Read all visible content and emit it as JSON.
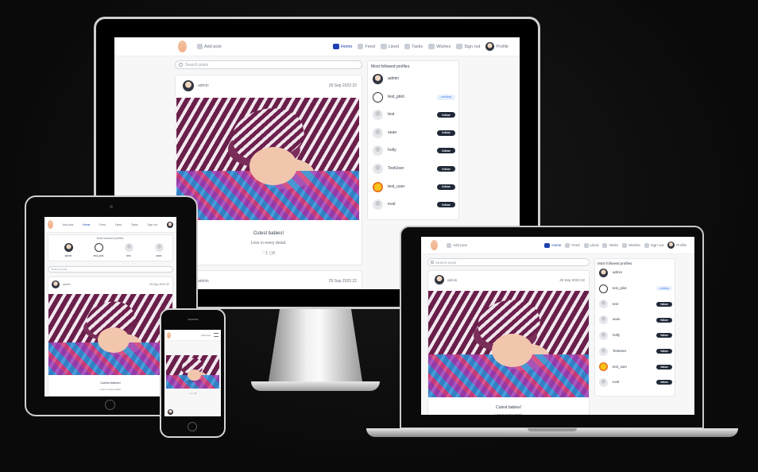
{
  "nav": {
    "add_post": "Add post",
    "home": "Home",
    "feed": "Feed",
    "liked": "Liked",
    "tasks": "Tasks",
    "wishes": "Wishes",
    "sign_out": "Sign out",
    "profile": "Profile",
    "tablet_add": "Add post",
    "tablet_sign": "Sign out"
  },
  "search": {
    "placeholder": "Search posts"
  },
  "post": {
    "author": "admin",
    "date": "29 Sep 2023 22",
    "title": "Cutest babies!",
    "body": "Love in every detail.",
    "likes": "1",
    "comments": "0"
  },
  "next_post": {
    "author": "admin",
    "date": "29 Sep 2023 22"
  },
  "sidebar": {
    "title": "Most followed profiles.",
    "profiles": [
      {
        "name": "admin",
        "action": "",
        "avatar": "admin"
      },
      {
        "name": "test_pilot",
        "action": "unfollow",
        "avatar": "line"
      },
      {
        "name": "test",
        "action": "follow",
        "avatar": "grey"
      },
      {
        "name": "sean",
        "action": "follow",
        "avatar": "grey"
      },
      {
        "name": "holly",
        "action": "follow",
        "avatar": "grey"
      },
      {
        "name": "TestUser",
        "action": "follow",
        "avatar": "grey"
      },
      {
        "name": "test_user",
        "action": "follow",
        "avatar": "yellow"
      },
      {
        "name": "eval",
        "action": "follow",
        "avatar": "grey"
      }
    ]
  },
  "tablet_profiles": [
    "admin",
    "test_pilot",
    "test",
    "sean"
  ],
  "colors": {
    "accent": "#1e40af",
    "button": "#1f2937",
    "unfollow_bg": "#e8effd",
    "unfollow_fg": "#3b82f6"
  }
}
